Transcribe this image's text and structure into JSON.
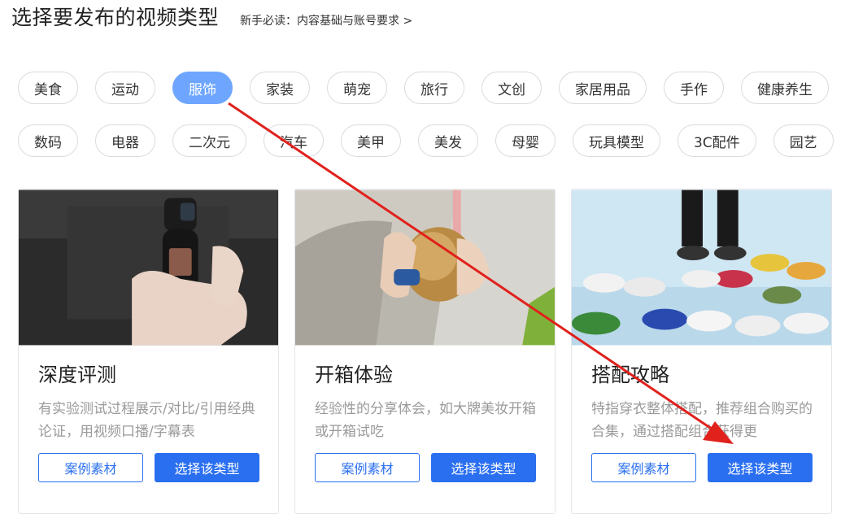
{
  "header": {
    "title": "选择要发布的视频类型",
    "guide_link": "新手必读：内容基础与账号要求 >"
  },
  "categories_row1": [
    "美食",
    "运动",
    "服饰",
    "家装",
    "萌宠",
    "旅行",
    "文创",
    "家居用品",
    "手作",
    "健康养生"
  ],
  "categories_row2": [
    "数码",
    "电器",
    "二次元",
    "汽车",
    "美甲",
    "美发",
    "母婴",
    "玩具模型",
    "3C配件",
    "园艺"
  ],
  "active_category": "服饰",
  "cards": [
    {
      "title": "深度评测",
      "desc": "有实验测试过程展示/对比/引用经典论证，用视频口播/字幕表",
      "case_label": "案例素材",
      "select_label": "选择该类型"
    },
    {
      "title": "开箱体验",
      "desc": "经验性的分享体会，如大牌美妆开箱或开箱试吃",
      "case_label": "案例素材",
      "select_label": "选择该类型"
    },
    {
      "title": "搭配攻略",
      "desc": "特指穿衣整体搭配，推荐组合购买的合集，通过搭配组合获得更",
      "case_label": "案例素材",
      "select_label": "选择该类型"
    }
  ],
  "colors": {
    "accent": "#2a6ff0",
    "active_chip": "#6ea6ff",
    "arrow": "#e0211c"
  }
}
